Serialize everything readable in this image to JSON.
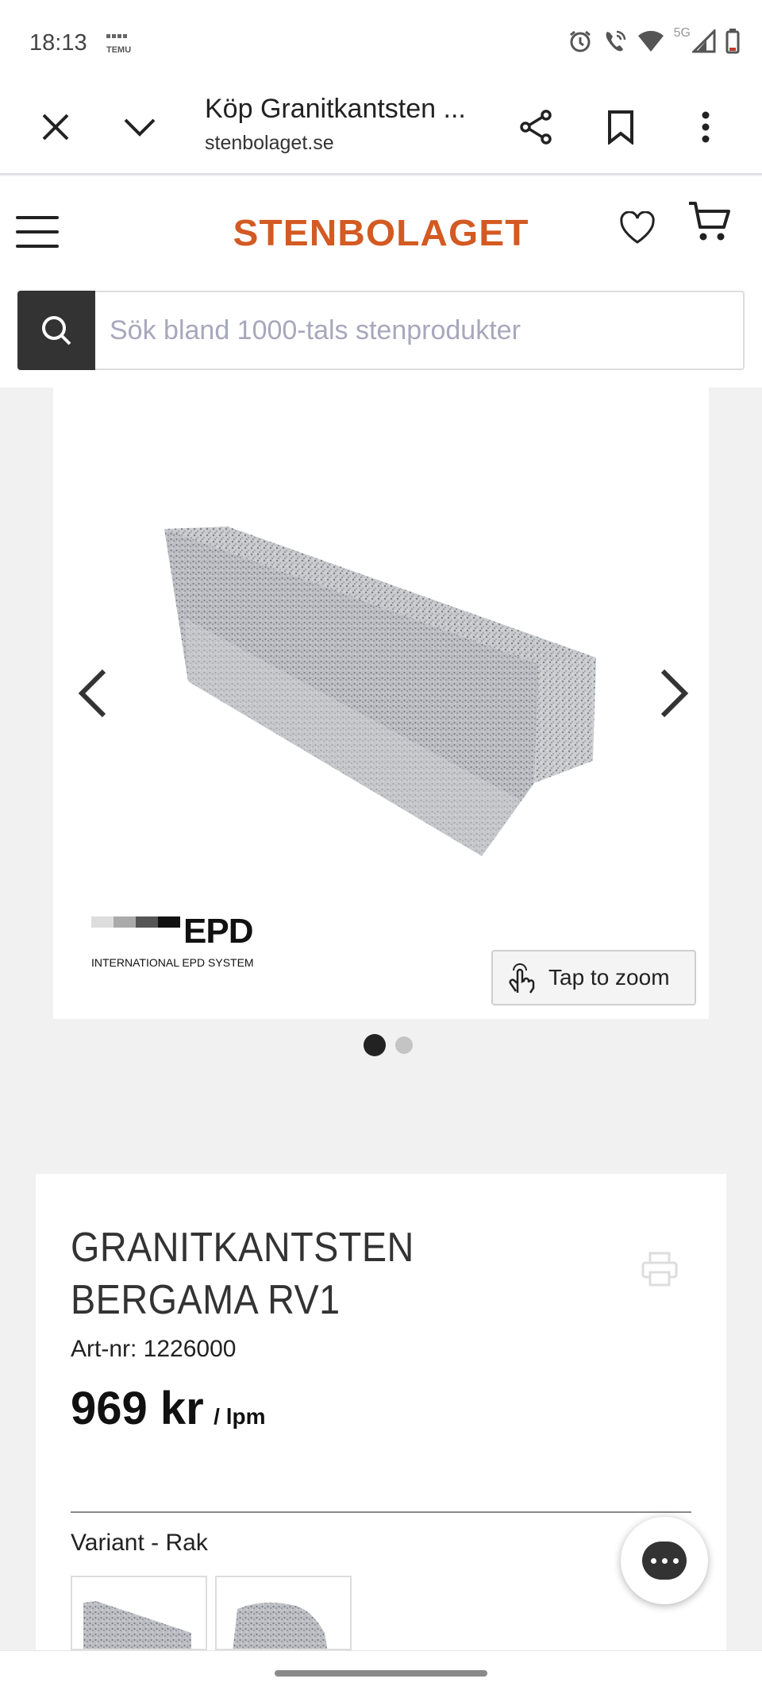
{
  "status_bar": {
    "time": "18:13",
    "app_label": "TEMU",
    "network": "5G"
  },
  "browser": {
    "tab_title": "Köp Granitkantsten ...",
    "url": "stenbolaget.se",
    "icons": [
      "close-icon",
      "chevron-down-icon",
      "share-icon",
      "bookmark-icon",
      "more-vert-icon"
    ]
  },
  "site": {
    "logo": "STENBOLAGET",
    "brand_color": "#d35a22",
    "search_placeholder": "Sök bland 1000-tals stenprodukter"
  },
  "gallery": {
    "epd_logo": "EPD",
    "epd_subtitle": "INTERNATIONAL EPD SYSTEM",
    "zoom_label": "Tap to zoom",
    "slide_count": 2,
    "active_slide": 1
  },
  "product": {
    "title": "GRANITKANTSTEN BERGAMA RV1",
    "art_nr": "Art-nr: 1226000",
    "price": "969 kr",
    "price_unit": "/ lpm",
    "variant_label": "Variant - Rak"
  }
}
